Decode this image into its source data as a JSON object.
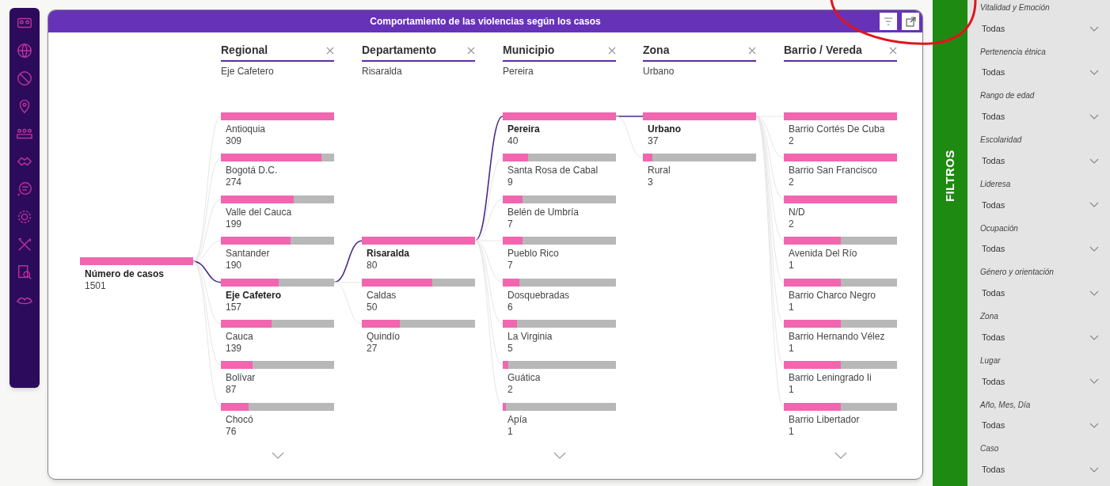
{
  "title": "Comportamiento de las violencias según los casos",
  "root": {
    "label": "Número de casos",
    "value": "1501",
    "level": 1
  },
  "levels": [
    {
      "header": "Regional",
      "selection": "Eje Cafetero",
      "more": true,
      "nodes": [
        {
          "label": "Antioquia",
          "value": "309",
          "level": 1,
          "selected": false
        },
        {
          "label": "Bogotá D.C.",
          "value": "274",
          "level": 0.887,
          "selected": false
        },
        {
          "label": "Valle del Cauca",
          "value": "199",
          "level": 0.644,
          "selected": false
        },
        {
          "label": "Santander",
          "value": "190",
          "level": 0.615,
          "selected": false
        },
        {
          "label": "Eje Cafetero",
          "value": "157",
          "level": 0.508,
          "selected": true
        },
        {
          "label": "Cauca",
          "value": "139",
          "level": 0.45,
          "selected": false
        },
        {
          "label": "Bolívar",
          "value": "87",
          "level": 0.282,
          "selected": false
        },
        {
          "label": "Chocó",
          "value": "76",
          "level": 0.246,
          "selected": false
        }
      ]
    },
    {
      "header": "Departamento",
      "selection": "Risaralda",
      "more": false,
      "nodes": [
        {
          "label": "Risaralda",
          "value": "80",
          "level": 1,
          "selected": true
        },
        {
          "label": "Caldas",
          "value": "50",
          "level": 0.625,
          "selected": false
        },
        {
          "label": "Quindío",
          "value": "27",
          "level": 0.338,
          "selected": false
        }
      ]
    },
    {
      "header": "Municipio",
      "selection": "Pereira",
      "more": true,
      "nodes": [
        {
          "label": "Pereira",
          "value": "40",
          "level": 1,
          "selected": true
        },
        {
          "label": "Santa Rosa de Cabal",
          "value": "9",
          "level": 0.225,
          "selected": false
        },
        {
          "label": "Belén de Umbría",
          "value": "7",
          "level": 0.175,
          "selected": false
        },
        {
          "label": "Pueblo Rico",
          "value": "7",
          "level": 0.175,
          "selected": false
        },
        {
          "label": "Dosquebradas",
          "value": "6",
          "level": 0.15,
          "selected": false
        },
        {
          "label": "La Virginia",
          "value": "5",
          "level": 0.125,
          "selected": false
        },
        {
          "label": "Guática",
          "value": "2",
          "level": 0.05,
          "selected": false
        },
        {
          "label": "Apía",
          "value": "1",
          "level": 0.025,
          "selected": false
        }
      ]
    },
    {
      "header": "Zona",
      "selection": "Urbano",
      "more": false,
      "nodes": [
        {
          "label": "Urbano",
          "value": "37",
          "level": 1,
          "selected": true
        },
        {
          "label": "Rural",
          "value": "3",
          "level": 0.081,
          "selected": false
        }
      ]
    },
    {
      "header": "Barrio / Vereda",
      "more": true,
      "nodes": [
        {
          "label": "Barrio Cortés De Cuba",
          "value": "2",
          "level": 1,
          "selected": false
        },
        {
          "label": "Barrio San Francisco",
          "value": "2",
          "level": 1,
          "selected": false
        },
        {
          "label": "N/D",
          "value": "2",
          "level": 1,
          "selected": false
        },
        {
          "label": "Avenida Del Río",
          "value": "1",
          "level": 0.5,
          "selected": false
        },
        {
          "label": "Barrio Charco Negro",
          "value": "1",
          "level": 0.5,
          "selected": false
        },
        {
          "label": "Barrio Hernando Vélez",
          "value": "1",
          "level": 0.5,
          "selected": false
        },
        {
          "label": "Barrio Leningrado Ii",
          "value": "1",
          "level": 0.5,
          "selected": false
        },
        {
          "label": "Barrio Libertador",
          "value": "1",
          "level": 0.5,
          "selected": false
        }
      ]
    }
  ],
  "filter_tab": "FILTROS",
  "filters": [
    {
      "label": "Vitalidad y Emoción",
      "value": "Todas"
    },
    {
      "label": "Pertenencia étnica",
      "value": "Todas"
    },
    {
      "label": "Rango de edad",
      "value": "Todas"
    },
    {
      "label": "Escolaridad",
      "value": "Todas"
    },
    {
      "label": "Lideresa",
      "value": "Todas"
    },
    {
      "label": "Ocupación",
      "value": "Todas"
    },
    {
      "label": "Género y orientación",
      "value": "Todas"
    },
    {
      "label": "Zona",
      "value": "Todas"
    },
    {
      "label": "Lugar",
      "value": "Todas"
    },
    {
      "label": "Año, Mes, Día",
      "value": "Todas"
    },
    {
      "label": "Caso",
      "value": "Todas"
    }
  ]
}
